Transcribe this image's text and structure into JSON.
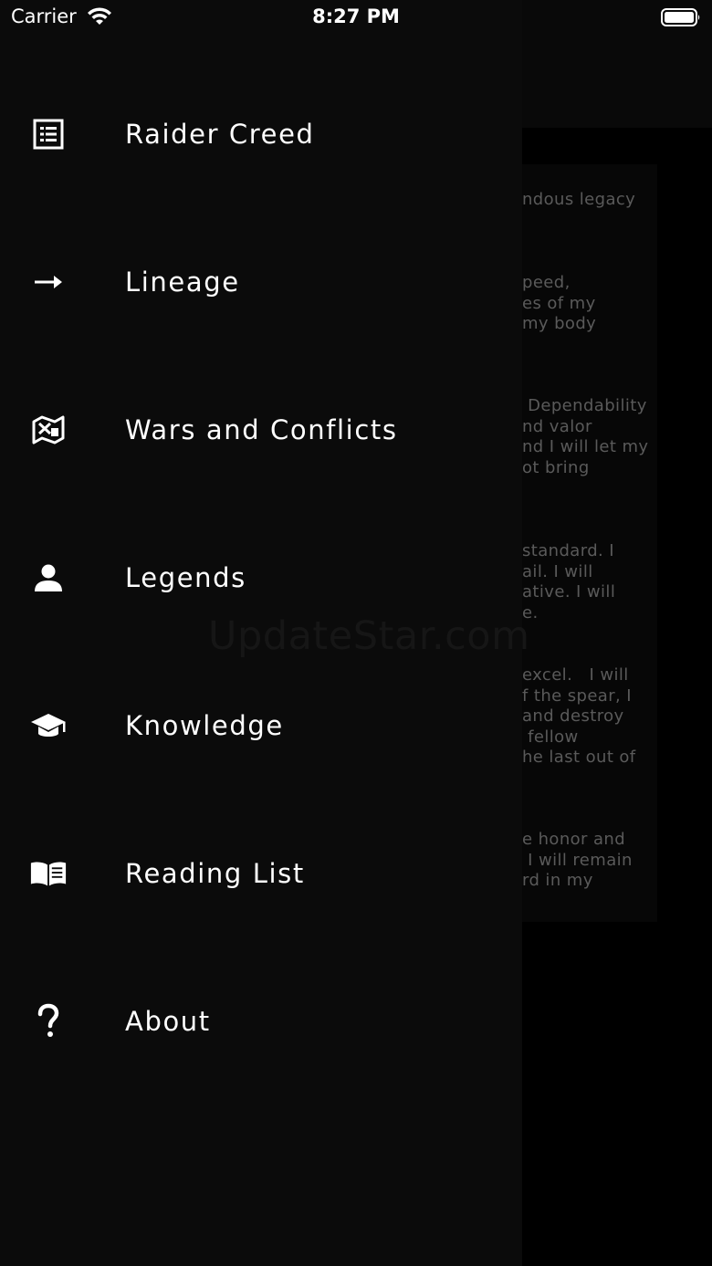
{
  "status_bar": {
    "carrier": "Carrier",
    "time": "8:27 PM"
  },
  "drawer": {
    "items": [
      {
        "label": "Raider Creed",
        "icon": "list-icon"
      },
      {
        "label": "Lineage",
        "icon": "arrow-right-icon"
      },
      {
        "label": "Wars and Conflicts",
        "icon": "map-icon"
      },
      {
        "label": "Legends",
        "icon": "person-icon"
      },
      {
        "label": "Knowledge",
        "icon": "graduation-cap-icon"
      },
      {
        "label": "Reading List",
        "icon": "open-book-icon"
      },
      {
        "label": "About",
        "icon": "question-mark-icon"
      }
    ]
  },
  "background_page": {
    "paragraphs": [
      "ndous legacy",
      "peed,\nes of my\nmy body",
      " Dependability\nnd valor\nnd I will let my\not bring",
      "standard. I\nail. I will\native. I will\ne.",
      "excel.   I will\nf the spear, I\nand destroy\n fellow\nhe last out of",
      "e honor and\n I will remain\nrd in my"
    ]
  },
  "watermark": "UpdateStar.com",
  "colors": {
    "drawer_background": "#0b0b0b",
    "page_background": "#000000",
    "text": "#ffffff",
    "muted_text": "#5a5a5a"
  }
}
